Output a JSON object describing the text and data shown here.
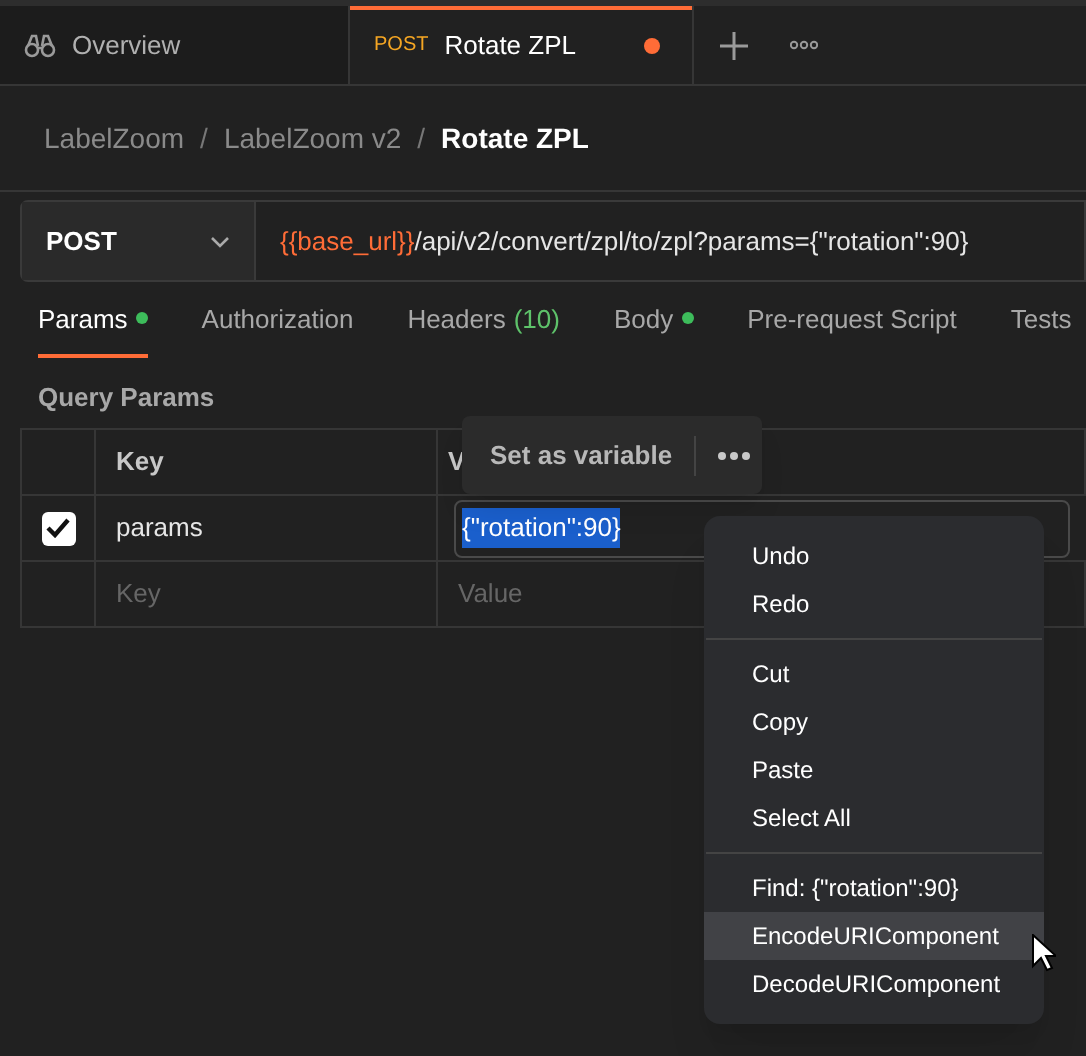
{
  "tabs": [
    {
      "kind": "overview",
      "label": "Overview",
      "selected": false
    },
    {
      "kind": "request",
      "method": "POST",
      "label": "Rotate ZPL",
      "selected": true,
      "unsaved": true
    }
  ],
  "breadcrumb": [
    "LabelZoom",
    "LabelZoom v2",
    "Rotate ZPL"
  ],
  "breadcrumb_separator": "/",
  "request": {
    "method": "POST",
    "url_variable": "{{base_url}}",
    "url_path": "/api/v2/convert/zpl/to/zpl?params={\"rotation\":90}"
  },
  "request_tabs": [
    {
      "label": "Params",
      "selected": true,
      "dot": true
    },
    {
      "label": "Authorization",
      "selected": false,
      "dot": false
    },
    {
      "label": "Headers",
      "count": "(10)",
      "selected": false,
      "dot": false
    },
    {
      "label": "Body",
      "selected": false,
      "dot": true
    },
    {
      "label": "Pre-request Script",
      "selected": false,
      "dot": false
    },
    {
      "label": "Tests",
      "selected": false,
      "dot": false
    }
  ],
  "query_params": {
    "title": "Query Params",
    "columns": [
      "Key",
      "V"
    ],
    "rows": [
      {
        "checked": true,
        "key": "params",
        "value": "{\"rotation\":90}",
        "value_selected": true
      }
    ],
    "placeholder_row": {
      "key": "Key",
      "value": "Value"
    }
  },
  "popover": {
    "label": "Set as variable"
  },
  "context_menu": {
    "groups": [
      [
        {
          "label": "Undo",
          "selected": false
        },
        {
          "label": "Redo",
          "selected": false
        }
      ],
      [
        {
          "label": "Cut",
          "selected": false
        },
        {
          "label": "Copy",
          "selected": false
        },
        {
          "label": "Paste",
          "selected": false
        },
        {
          "label": "Select All",
          "selected": false
        }
      ],
      [
        {
          "label": "Find: {\"rotation\":90}",
          "selected": false
        },
        {
          "label": "EncodeURIComponent",
          "selected": true
        },
        {
          "label": "DecodeURIComponent",
          "selected": false
        }
      ]
    ]
  }
}
